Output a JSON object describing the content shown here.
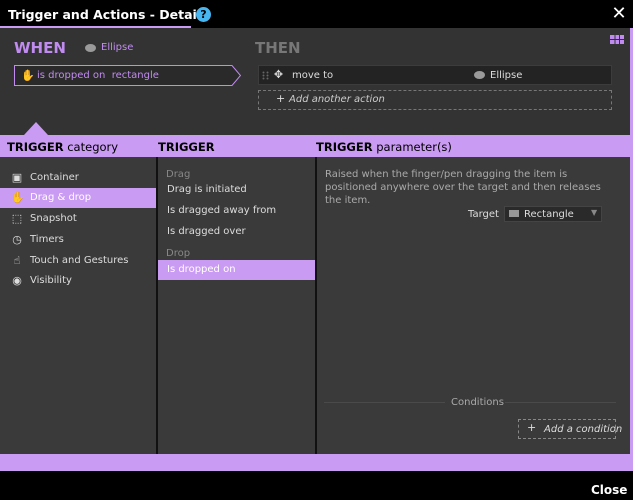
{
  "window": {
    "title": "Trigger and Actions - Details",
    "help_glyph": "?",
    "close_glyph": "✕"
  },
  "when": {
    "label": "WHEN",
    "target": "Ellipse",
    "trigger_text": "is dropped on",
    "trigger_target": "rectangle"
  },
  "then": {
    "label": "THEN",
    "action": "move to",
    "action_target": "Ellipse",
    "add_action": "Add another action"
  },
  "columns": {
    "category_bold": "TRIGGER",
    "category_rest": "category",
    "trigger": "TRIGGER",
    "params_bold": "TRIGGER",
    "params_rest": "parameter(s)"
  },
  "categories": [
    {
      "label": "Container",
      "icon": "container-icon"
    },
    {
      "label": "Drag & drop",
      "icon": "drag-drop-icon"
    },
    {
      "label": "Snapshot",
      "icon": "snapshot-icon"
    },
    {
      "label": "Timers",
      "icon": "timer-icon"
    },
    {
      "label": "Touch and Gestures",
      "icon": "hand-icon"
    },
    {
      "label": "Visibility",
      "icon": "eye-icon"
    }
  ],
  "trigger_groups": {
    "drag": "Drag",
    "drop": "Drop"
  },
  "triggers": [
    "Drag is initiated",
    "Is dragged away from",
    "Is dragged over",
    "Is dropped on"
  ],
  "params": {
    "description": "Raised when the finger/pen dragging the item is positioned anywhere over the target and then releases the item.",
    "target_label": "Target",
    "target_value": "Rectangle",
    "conditions_label": "Conditions",
    "add_condition": "Add a condition"
  },
  "footer": {
    "close": "Close"
  },
  "colors": {
    "accent": "#c99bf2",
    "when_text": "#c18cf0",
    "help": "#47b5f0"
  }
}
